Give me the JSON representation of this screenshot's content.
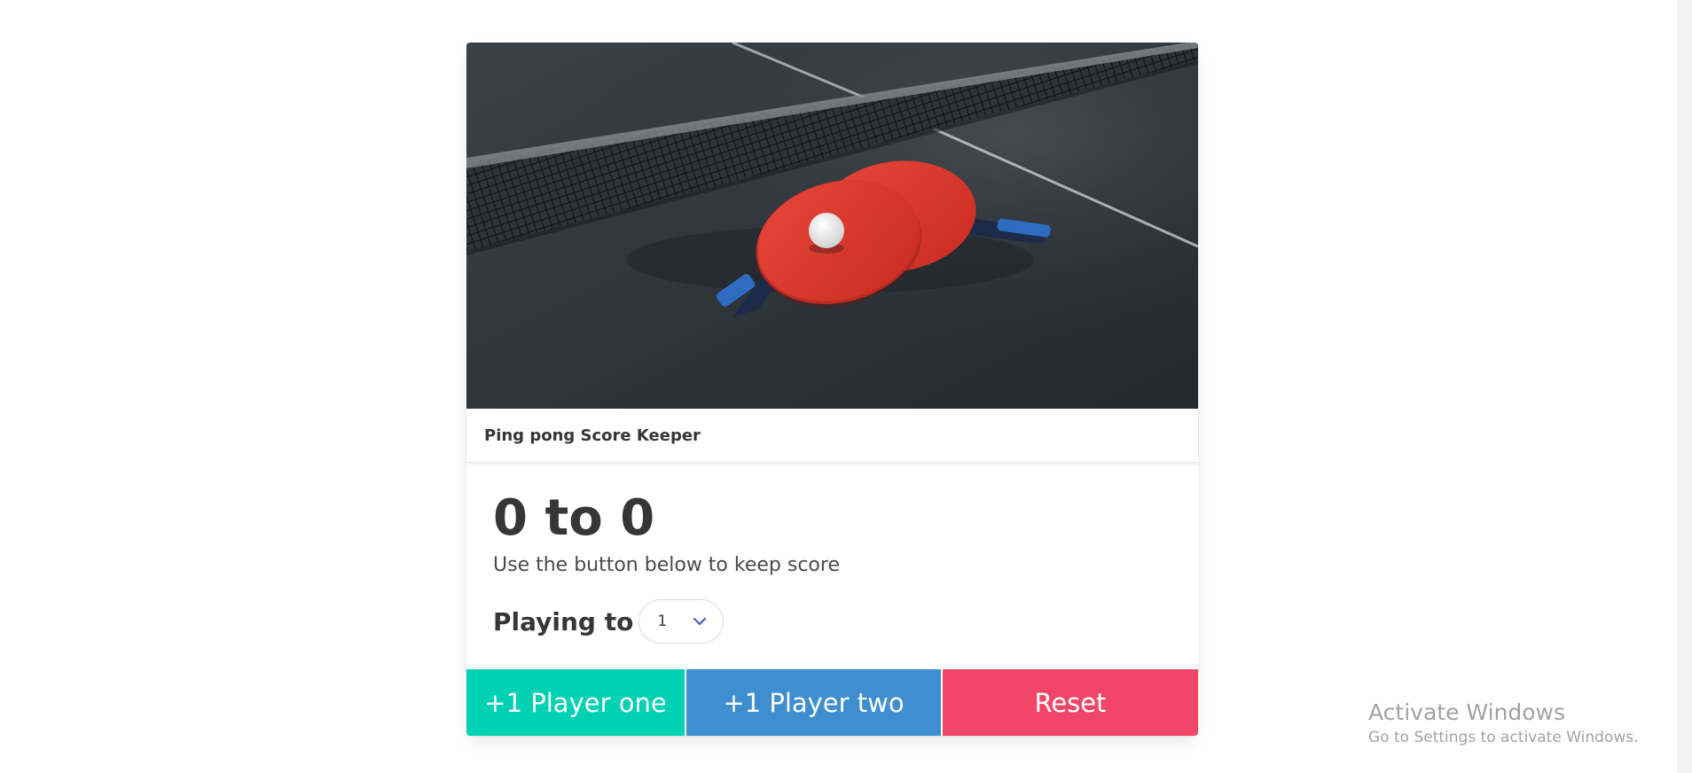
{
  "card": {
    "header_title": "Ping pong Score Keeper",
    "score_text": "0 to 0",
    "subtitle": "Use the button below to keep score",
    "playing_to_label": "Playing to",
    "playing_to_value": "1",
    "image_alt_icon": "ping-pong-paddles-image"
  },
  "buttons": {
    "player_one": "+1 Player one",
    "player_two": "+1 Player two",
    "reset": "Reset"
  },
  "colors": {
    "player_one": "#00d1b2",
    "player_two": "#3e8ed0",
    "reset": "#f14668",
    "select_chevron": "#485fc7"
  },
  "watermark": {
    "title": "Activate Windows",
    "subtitle": "Go to Settings to activate Windows."
  }
}
